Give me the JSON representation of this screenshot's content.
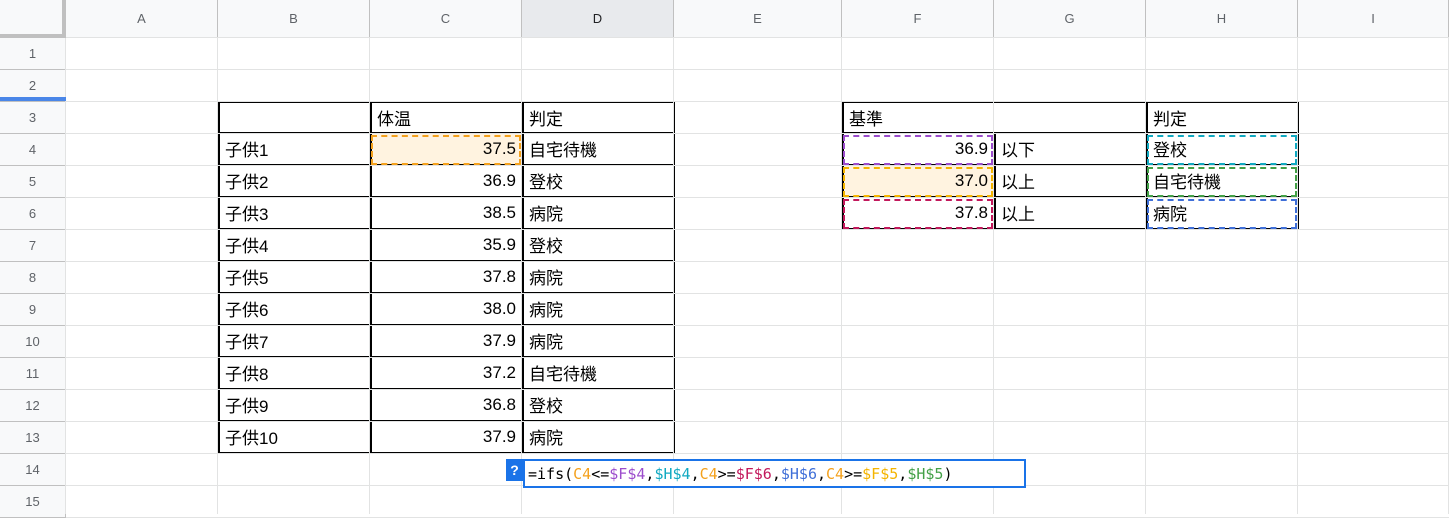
{
  "columns": [
    "A",
    "B",
    "C",
    "D",
    "E",
    "F",
    "G",
    "H",
    "I"
  ],
  "rows": [
    "1",
    "2",
    "3",
    "4",
    "5",
    "6",
    "7",
    "8",
    "9",
    "10",
    "11",
    "12",
    "13",
    "14",
    "15"
  ],
  "table1": {
    "header": [
      "",
      "体温",
      "判定"
    ],
    "rows": [
      [
        "子供1",
        "37.5",
        "自宅待機"
      ],
      [
        "子供2",
        "36.9",
        "登校"
      ],
      [
        "子供3",
        "38.5",
        "病院"
      ],
      [
        "子供4",
        "35.9",
        "登校"
      ],
      [
        "子供5",
        "37.8",
        "病院"
      ],
      [
        "子供6",
        "38.0",
        "病院"
      ],
      [
        "子供7",
        "37.9",
        "病院"
      ],
      [
        "子供8",
        "37.2",
        "自宅待機"
      ],
      [
        "子供9",
        "36.8",
        "登校"
      ],
      [
        "子供10",
        "37.9",
        "病院"
      ]
    ]
  },
  "table2": {
    "header_criteria": "基準",
    "header_result": "判定",
    "rows": [
      [
        "36.9",
        "以下",
        "登校"
      ],
      [
        "37.0",
        "以上",
        "自宅待機"
      ],
      [
        "37.8",
        "以上",
        "病院"
      ]
    ]
  },
  "formula": {
    "help_label": "?",
    "parts": [
      {
        "text": "=ifs(",
        "color": "#000000"
      },
      {
        "text": "C4",
        "color": "#f4a11d"
      },
      {
        "text": "<=",
        "color": "#000000"
      },
      {
        "text": "$F$4",
        "color": "#9c4dcc"
      },
      {
        "text": ",",
        "color": "#000000"
      },
      {
        "text": "$H$4",
        "color": "#11a9c1"
      },
      {
        "text": ",",
        "color": "#000000"
      },
      {
        "text": "C4",
        "color": "#f4a11d"
      },
      {
        "text": ">=",
        "color": "#000000"
      },
      {
        "text": "$F$6",
        "color": "#c2185b"
      },
      {
        "text": ",",
        "color": "#000000"
      },
      {
        "text": "$H$6",
        "color": "#3f6fd8"
      },
      {
        "text": ",",
        "color": "#000000"
      },
      {
        "text": "C4",
        "color": "#f4a11d"
      },
      {
        "text": ">=",
        "color": "#000000"
      },
      {
        "text": "$F$5",
        "color": "#f4b400"
      },
      {
        "text": ",",
        "color": "#000000"
      },
      {
        "text": "$H$5",
        "color": "#43a047"
      },
      {
        "text": ")",
        "color": "#000000"
      }
    ]
  },
  "colors": {
    "selection_blue": "#1a73e8",
    "active_cell_fill": "#fff3e0",
    "c4_outline": "#f4a11d",
    "f4_outline": "#9c4dcc",
    "f5_outline": "#f4b400",
    "f6_outline": "#c2185b",
    "h4_outline": "#11a9c1",
    "h5_outline": "#43a047",
    "h6_outline": "#3f6fd8"
  }
}
